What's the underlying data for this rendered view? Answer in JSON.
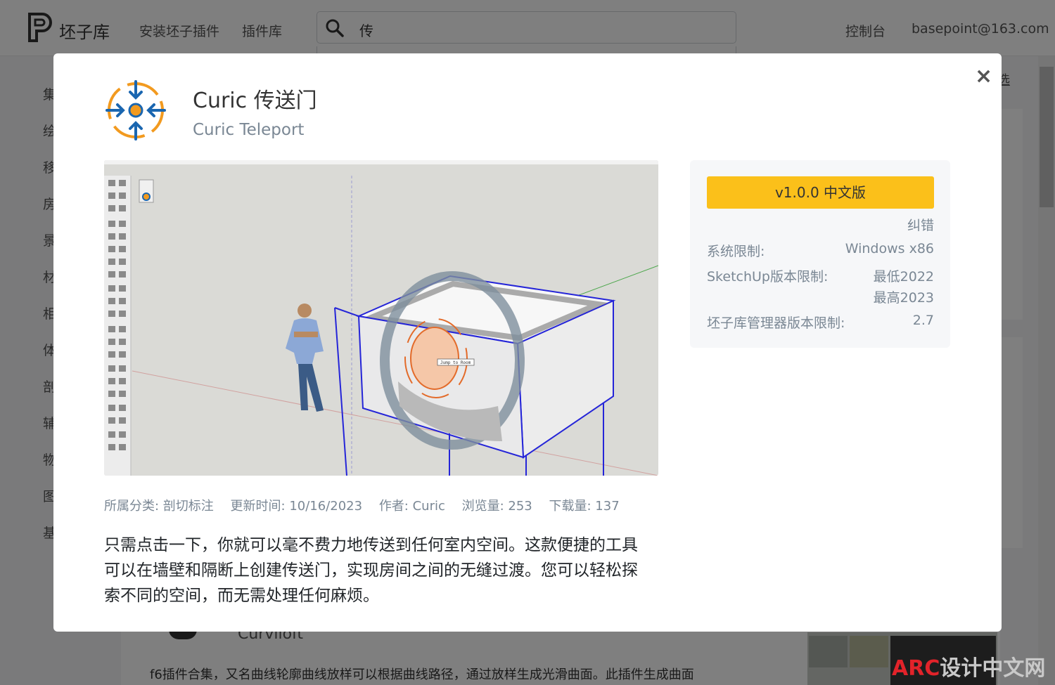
{
  "header": {
    "brand": "坯子库",
    "nav": [
      "安装坯子插件",
      "插件库"
    ],
    "search_value": "传",
    "console": "控制台",
    "user": "basepoint@163.com"
  },
  "sidebar": {
    "categories": [
      "集",
      "绘",
      "移",
      "房",
      "景",
      "材",
      "相",
      "体",
      "剖",
      "辅",
      "物",
      "图",
      "基"
    ]
  },
  "background": {
    "filter_label": "选",
    "card_name": "Curviloft",
    "card_desc": "f6插件合集，又名曲线轮廓曲线放样可以根据曲线路径，通过放样生成光滑曲面。此插件生成曲面",
    "watermark_red": "ARC",
    "watermark_gray": "设计中文网"
  },
  "modal": {
    "title": "Curic 传送门",
    "subtitle": "Curic Teleport",
    "close_glyph": "×",
    "meta": [
      "所属分类: 剖切标注",
      "更新时间: 10/16/2023",
      "作者: Curic",
      "浏览量: 253",
      "下载量: 137"
    ],
    "description": "只需点击一下，你就可以毫不费力地传送到任何室内空间。这款便捷的工具可以在墙壁和隔断上创建传送门，实现房间之间的无缝过渡。您可以轻松探索不同的空间，而无需处理任何麻烦。",
    "screenshot_label": "Jump to Room",
    "version_button": "v1.0.0 中文版",
    "report": "纠错",
    "info": {
      "system_label": "系统限制:",
      "system_value": "Windows x86",
      "sketchup_label": "SketchUp版本限制:",
      "sketchup_min": "最低2022",
      "sketchup_max": "最高2023",
      "manager_label": "坯子库管理器版本限制:",
      "manager_value": "2.7"
    }
  },
  "colors": {
    "accent": "#fbc01a",
    "icon_blue": "#1a66b0",
    "icon_orange": "#f29a1f",
    "muted_text": "#7a8794"
  },
  "icons": [
    "search-icon",
    "close-icon",
    "teleport-icon",
    "brand-logo"
  ]
}
